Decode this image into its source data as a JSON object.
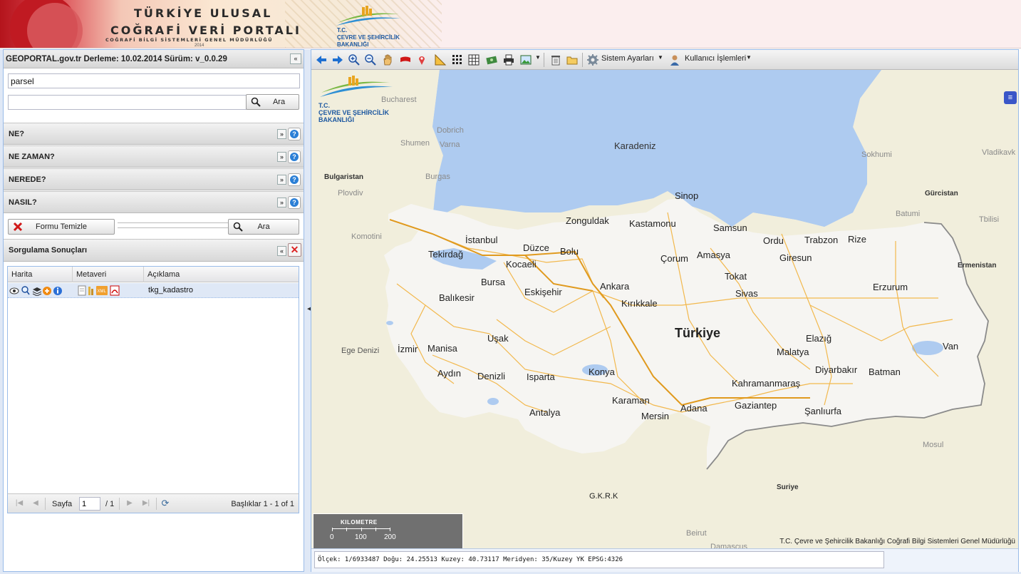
{
  "banner": {
    "line1": "TÜRKİYE ULUSAL",
    "line2": "COĞRAFİ VERİ PORTALI",
    "line3": "COĞRAFİ BİLGİ SİSTEMLERİ GENEL MÜDÜRLÜĞÜ",
    "year": "2014",
    "ministry": {
      "line1": "T.C.",
      "line2": "ÇEVRE VE ŞEHİRCİLİK",
      "line3": "BAKANLIĞI"
    }
  },
  "left_panel": {
    "title": "GEOPORTAL.gov.tr Derleme: 10.02.2014 Sürüm: v_0.0.29",
    "search_value": "parsel",
    "search2_value": "",
    "search_button": "Ara",
    "sections": [
      {
        "label": "NE?"
      },
      {
        "label": "NE ZAMAN?"
      },
      {
        "label": "NEREDE?"
      },
      {
        "label": "NASIL?"
      }
    ],
    "clear_button": "Formu Temizle",
    "search_button2": "Ara",
    "progress": 0
  },
  "results": {
    "title": "Sorgulama Sonuçları",
    "columns": [
      "Harita",
      "Metaveri",
      "Açıklama"
    ],
    "rows": [
      {
        "description": "tkg_kadastro"
      }
    ],
    "pager": {
      "page_label": "Sayfa",
      "page_value": "1",
      "of_label": "/ 1",
      "summary": "Başlıklar 1 - 1 of 1"
    }
  },
  "map_toolbar": {
    "system_settings": "Sistem Ayarları",
    "user_ops": "Kullanıcı İşlemleri",
    "icons": [
      "back-arrow-icon",
      "forward-arrow-icon",
      "zoom-in-icon",
      "zoom-out-icon",
      "pan-hand-icon",
      "flag-icon",
      "marker-icon",
      "measure-icon",
      "grid-small-icon",
      "grid-large-icon",
      "money-icon",
      "print-icon",
      "image-export-icon",
      "trash-icon",
      "folder-icon"
    ]
  },
  "map": {
    "watermark": {
      "line1": "T.C.",
      "line2": "ÇEVRE VE ŞEHİRCİLİK",
      "line3": "BAKANLIĞI"
    },
    "sea_label": "Karadeniz",
    "country_label": "Türkiye",
    "cities": [
      "Sinop",
      "Zonguldak",
      "Kastamonu",
      "Samsun",
      "Ordu",
      "Trabzon",
      "Rize",
      "İstanbul",
      "Tekirdağ",
      "Düzce",
      "Bolu",
      "Kocaeli",
      "Çorum",
      "Amasya",
      "Giresun",
      "Bursa",
      "Tokat",
      "Balıkesir",
      "Eskişehir",
      "Ankara",
      "Sivas",
      "Erzurum",
      "Kırıkkale",
      "Uşak",
      "Elazığ",
      "Manisa",
      "İzmir",
      "Malatya",
      "Van",
      "Aydın",
      "Denizli",
      "Isparta",
      "Konya",
      "Diyarbakır",
      "Batman",
      "Kahramanmaraş",
      "Karaman",
      "Gaziantep",
      "Şanlıurfa",
      "Adana",
      "Mersin",
      "Antalya"
    ],
    "countries": [
      "Bulgaristan",
      "Gürcistan",
      "Ermenistan",
      "Suriye"
    ],
    "faint_places": [
      "Bucharest",
      "Dobrich",
      "Varna",
      "Shumen",
      "Burgas",
      "Plovdiv",
      "Komotini",
      "Sokhumi",
      "Vladikavk",
      "Batumi",
      "Tbilisi",
      "Ege Denizi",
      "Mosul",
      "Beirut",
      "Damascus"
    ],
    "gkrk_label": "G.K.R.K",
    "attribution": "T.C. Çevre ve Şehircilik Bakanlığı Coğrafi Bilgi Sistemleri Genel Müdürlüğü",
    "scale": {
      "title": "KILOMETRE",
      "ticks": [
        "0",
        "100",
        "200"
      ]
    },
    "status_line": "Ölçek: 1/6933487 Doğu: 24.25513 Kuzey: 40.73117 Meridyen: 35/Kuzey YK EPSG:4326"
  }
}
